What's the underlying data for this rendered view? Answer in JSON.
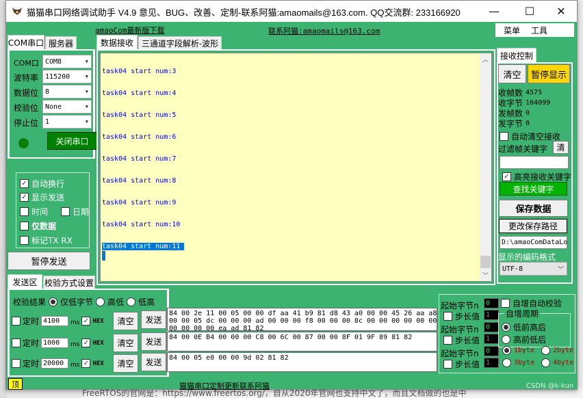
{
  "window": {
    "title": "猫猫串口网络调试助手 V4.9 意见、BUG、改善、定制-联系阿猫:amaomails@163.com. QQ交流群: 233166920",
    "minimize": "—",
    "maximize": "☐",
    "close": "✕"
  },
  "header": {
    "download_link": "amaoCom最新版下载",
    "contact_link": "联系阿猫:amaomails@163.com",
    "menu": [
      "菜单",
      "工具"
    ]
  },
  "conn_tabs": [
    "COM串口",
    "服务器"
  ],
  "serial": {
    "fields": [
      {
        "label": "COM口",
        "value": "COM8"
      },
      {
        "label": "波特率",
        "value": "115200"
      },
      {
        "label": "数据位",
        "value": "8"
      },
      {
        "label": "校验位",
        "value": "None"
      },
      {
        "label": "停止位",
        "value": "1"
      }
    ],
    "status_color": "#0a7d0a",
    "close_port_button": "关闭串口"
  },
  "options": {
    "auto_newline": {
      "label": "自动换行",
      "checked": true
    },
    "show_send": {
      "label": "显示发送",
      "checked": true
    },
    "time": {
      "label": "时间",
      "checked": false
    },
    "date": {
      "label": "日期",
      "checked": false
    },
    "data_only": {
      "label": "仅数据",
      "checked": false
    },
    "mark_txrx": {
      "label": "标记TX RX",
      "checked": false
    }
  },
  "pause_send_button": "暂停发送",
  "recv_tabs": [
    "数据接收",
    "三通道字段解析-波形"
  ],
  "received_lines": [
    "task04 start num:3",
    "task04 start num:4",
    "task04 start num:5",
    "task04 start num:6",
    "task04 start num:7",
    "task04 start num:8",
    "task04 start num:9",
    "task04 start num:10",
    "task04 start num:11"
  ],
  "recv_control": {
    "tab": "接收控制",
    "clear_button": "清空",
    "pause_display_button": "暂停显示",
    "stats": [
      {
        "label": "收帧数",
        "value": "4575"
      },
      {
        "label": "收字节",
        "value": "104099"
      },
      {
        "label": "发帧数",
        "value": "0"
      },
      {
        "label": "发字节",
        "value": "0"
      }
    ],
    "auto_clear": {
      "label": "自动清空接收",
      "checked": false
    },
    "filter_label": "过滤帧关键字",
    "filter_clear": "清",
    "filter_value": "",
    "highlight": {
      "label": "高亮接收关键字",
      "checked": true
    },
    "find_keyword_button": "查找关键字",
    "save_data_button": "保存数据",
    "change_path_button": "更改保存路径",
    "save_path": "D:\\amaoComDataLo",
    "encoding_label": "显示的编码格式",
    "encoding_value": "UTF-8"
  },
  "send_tabs": [
    "发送区",
    "校验方式设置"
  ],
  "checksum": {
    "label": "校验结果",
    "options": [
      {
        "label": "仅低字节",
        "selected": true
      },
      {
        "label": "高低",
        "selected": false
      },
      {
        "label": "低高",
        "selected": false
      }
    ]
  },
  "send_rows": [
    {
      "timer_label": "定时",
      "timer_checked": false,
      "interval": "4100",
      "unit": "ms",
      "hex_checked": true,
      "hex_label": "HEX",
      "clear": "清空",
      "send": "发送",
      "content": "84 00 2e 11 00 05 00 00 df aa 41 b9 81 d8 43 a0 00 00 45 26 aa a8\n00 00 05 dc 00 00 00 ad 00 00 00 f8 00 00 00 8c 00 00 00 00 00 00\n00 00 00 00 ea ad 81 82",
      "start_byte": "0",
      "step": "1",
      "step_checked": false
    },
    {
      "timer_label": "定时",
      "timer_checked": false,
      "interval": "1000",
      "unit": "ms",
      "hex_checked": true,
      "hex_label": "HEX",
      "clear": "清空",
      "send": "发送",
      "content": "84 00 0E B4 00 00 00 C8 00 6C 00 87 00 00 8F 01 9F 89 81 82",
      "start_byte": "0",
      "step": "1",
      "step_checked": false
    },
    {
      "timer_label": "定时",
      "timer_checked": false,
      "interval": "20000",
      "unit": "ms",
      "hex_checked": true,
      "hex_label": "HEX",
      "clear": "清空",
      "send": "发送",
      "content": "84 00 05 e0 00 00 9d 02 81 82",
      "start_byte": "0",
      "step": "1",
      "step_checked": false
    }
  ],
  "auto_inc": {
    "start_byte_label": "起始字节n",
    "step_label": "步长值",
    "auto_check": {
      "label": "自增自动校验",
      "checked": false
    },
    "period_title": "自增周期",
    "period_options": [
      {
        "label": "低前高后",
        "selected": true
      },
      {
        "label": "高前低后",
        "selected": false
      }
    ],
    "byte_options": [
      {
        "label": "1byte",
        "selected": true
      },
      {
        "label": "2byte",
        "selected": false
      },
      {
        "label": "3byte",
        "selected": false
      },
      {
        "label": "4byte",
        "selected": false
      }
    ]
  },
  "footer": {
    "top_button": "顶",
    "link": "猫猫串口定制更新联系阿猫",
    "watermark": "CSDN @k-kun"
  },
  "background_text": "FreeRTOS的官网是：https://www.freertos.org/，自从2020年官网也支持中文了，而且文档做的也是中",
  "colors": {
    "green": "#3cb371",
    "recv_bg": "#ffffc0",
    "recv_text": "#0000ee",
    "selection": "#0078d7",
    "pause_display": "#ffd700",
    "find_keyword": "#00b300",
    "close_port": "#008000",
    "byte_option_text": "#a00000"
  }
}
